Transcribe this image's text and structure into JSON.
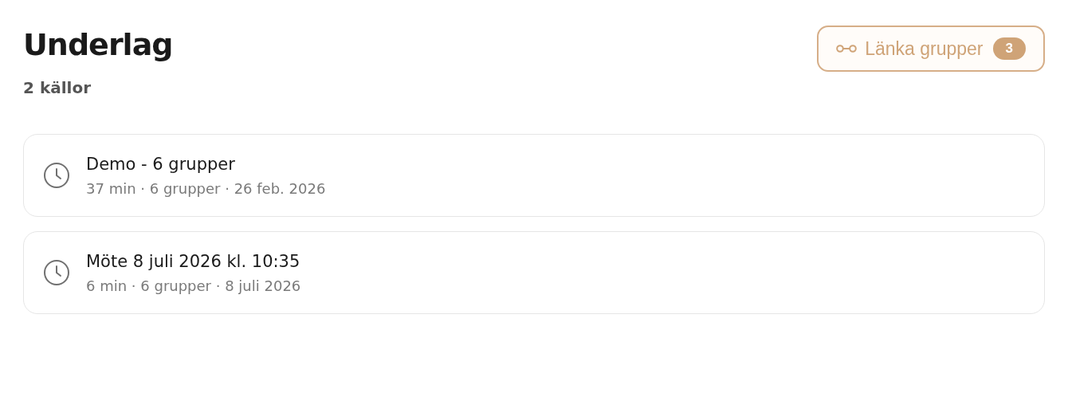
{
  "header": {
    "title": "Underlag",
    "subtitle": "2 källor"
  },
  "link_button": {
    "label": "Länka grupper",
    "count": "3"
  },
  "sources": [
    {
      "title": "Demo - 6 grupper",
      "meta": "37 min · 6 grupper · 26 feb. 2026"
    },
    {
      "title": "Möte 8 juli 2026 kl. 10:35",
      "meta": "6 min · 6 grupper · 8 juli 2026"
    }
  ]
}
